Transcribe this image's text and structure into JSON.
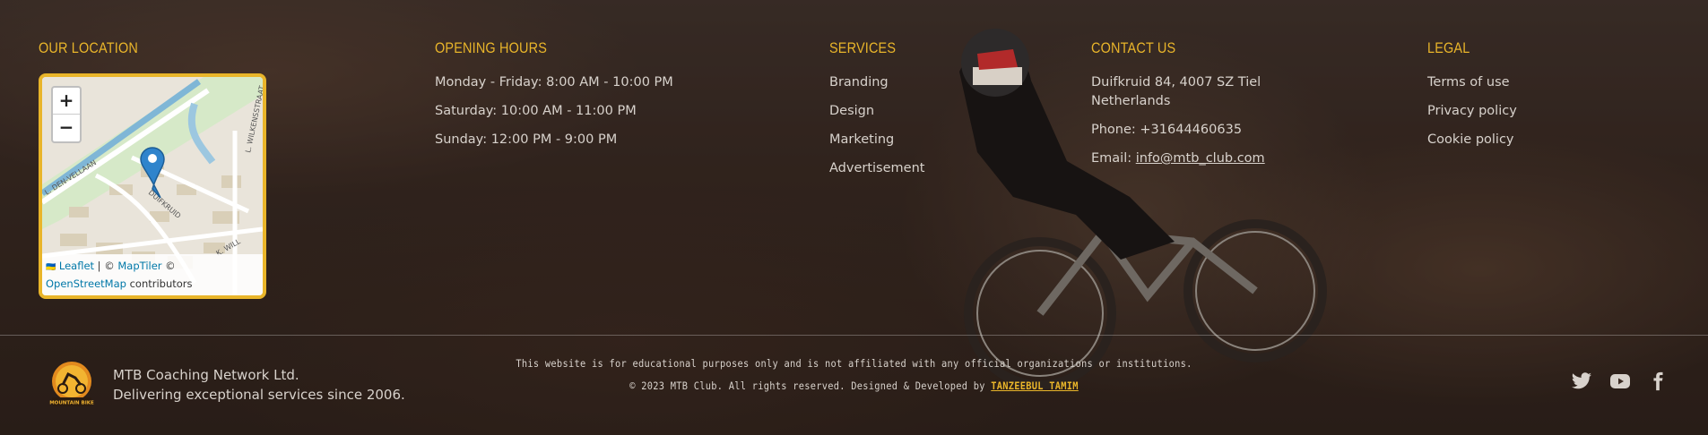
{
  "columns": {
    "location": {
      "title": "OUR LOCATION"
    },
    "hours": {
      "title": "OPENING HOURS",
      "lines": [
        "Monday - Friday: 8:00 AM - 10:00 PM",
        "Saturday: 10:00 AM - 11:00 PM",
        "Sunday: 12:00 PM - 9:00 PM"
      ]
    },
    "services": {
      "title": "SERVICES",
      "items": [
        "Branding",
        "Design",
        "Marketing",
        "Advertisement"
      ]
    },
    "contact": {
      "title": "CONTACT US",
      "address_line1": "Duifkruid 84, 4007 SZ Tiel",
      "address_line2": "Netherlands",
      "phone": "Phone: +31644460635",
      "email_label": "Email: ",
      "email": "info@mtb_club.com"
    },
    "legal": {
      "title": "LEGAL",
      "items": [
        "Terms of use",
        "Privacy policy",
        "Cookie policy"
      ]
    }
  },
  "map": {
    "zoom_in": "+",
    "zoom_out": "−",
    "street_labels": [
      "L. DEN-VELLAAN",
      "L. WILKENSSTRAAT",
      "DUIFKRUID",
      "K. WILL"
    ],
    "attribution": {
      "flag": "🇺🇦",
      "leaflet": "Leaflet",
      "sep": " | © ",
      "maptiler": "MapTiler",
      "copy": " © ",
      "osm": "OpenStreetMap",
      "contributors": " contributors"
    }
  },
  "footer": {
    "logo_text": "MOUNTAIN BIKE",
    "company_name": "MTB Coaching Network Ltd.",
    "tagline": "Delivering exceptional services since 2006.",
    "disclaimer": "This website is for educational purposes only and is not affiliated with any official organizations or institutions.",
    "copyright": "© 2023 MTB Club. All rights reserved. Designed & Developed by ",
    "author": "TANZEEBUL TAMIM"
  },
  "social": [
    "twitter-icon",
    "youtube-icon",
    "facebook-icon"
  ],
  "colors": {
    "accent": "#e9b52a",
    "text": "#d8d2cc",
    "map_border": "#e9b52a"
  }
}
